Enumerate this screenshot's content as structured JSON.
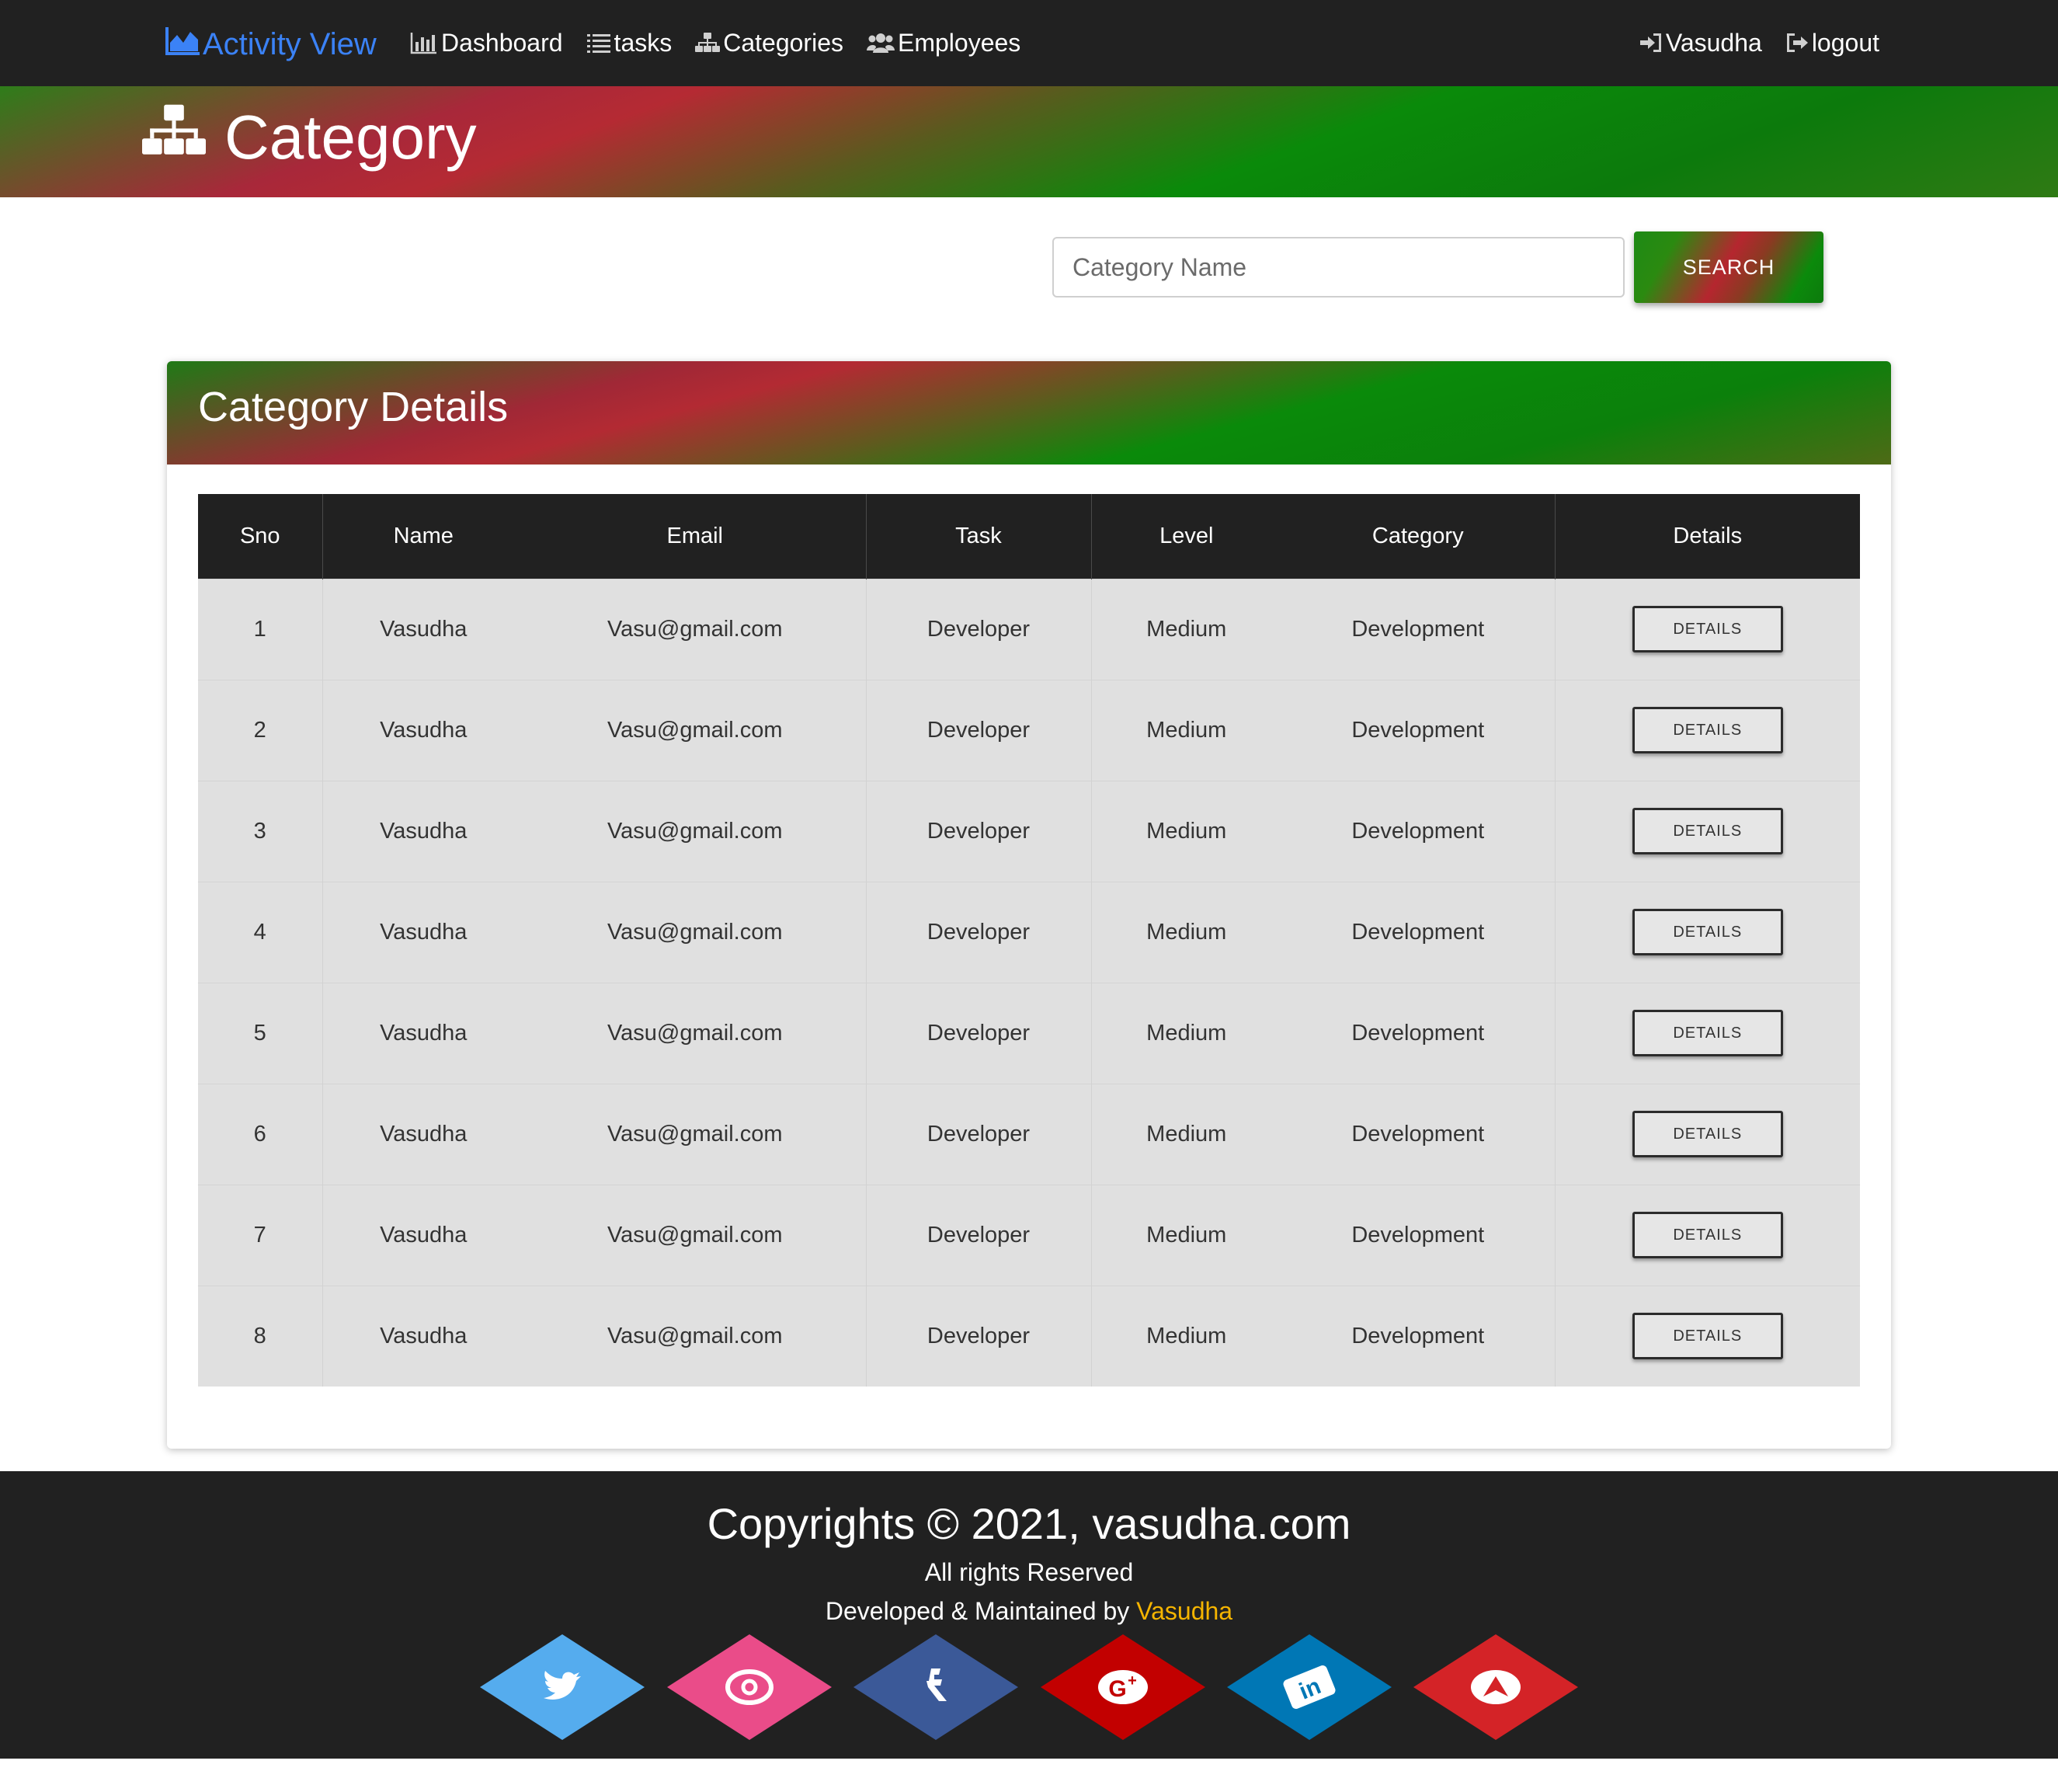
{
  "nav": {
    "brand": "Activity View",
    "links": [
      {
        "label": "Dashboard",
        "icon": "bar-chart-icon"
      },
      {
        "label": "tasks",
        "icon": "list-icon"
      },
      {
        "label": "Categories",
        "icon": "sitemap-icon"
      },
      {
        "label": "Employees",
        "icon": "users-icon"
      }
    ],
    "user": {
      "label": "Vasudha",
      "icon": "sign-in-icon"
    },
    "logout": {
      "label": "logout",
      "icon": "sign-out-icon"
    }
  },
  "banner": {
    "title": "Category",
    "icon": "sitemap-icon"
  },
  "search": {
    "placeholder": "Category Name",
    "value": "",
    "button_label": "SEARCH"
  },
  "card": {
    "title": "Category Details"
  },
  "table": {
    "columns": [
      "Sno",
      "Name",
      "Email",
      "Task",
      "Level",
      "Category",
      "Details"
    ],
    "rows": [
      {
        "sno": "1",
        "name": "Vasudha",
        "email": "Vasu@gmail.com",
        "task": "Developer",
        "level": "Medium",
        "category": "Development",
        "details": "DETAILS"
      },
      {
        "sno": "2",
        "name": "Vasudha",
        "email": "Vasu@gmail.com",
        "task": "Developer",
        "level": "Medium",
        "category": "Development",
        "details": "DETAILS"
      },
      {
        "sno": "3",
        "name": "Vasudha",
        "email": "Vasu@gmail.com",
        "task": "Developer",
        "level": "Medium",
        "category": "Development",
        "details": "DETAILS"
      },
      {
        "sno": "4",
        "name": "Vasudha",
        "email": "Vasu@gmail.com",
        "task": "Developer",
        "level": "Medium",
        "category": "Development",
        "details": "DETAILS"
      },
      {
        "sno": "5",
        "name": "Vasudha",
        "email": "Vasu@gmail.com",
        "task": "Developer",
        "level": "Medium",
        "category": "Development",
        "details": "DETAILS"
      },
      {
        "sno": "6",
        "name": "Vasudha",
        "email": "Vasu@gmail.com",
        "task": "Developer",
        "level": "Medium",
        "category": "Development",
        "details": "DETAILS"
      },
      {
        "sno": "7",
        "name": "Vasudha",
        "email": "Vasu@gmail.com",
        "task": "Developer",
        "level": "Medium",
        "category": "Development",
        "details": "DETAILS"
      },
      {
        "sno": "8",
        "name": "Vasudha",
        "email": "Vasu@gmail.com",
        "task": "Developer",
        "level": "Medium",
        "category": "Development",
        "details": "DETAILS"
      }
    ]
  },
  "footer": {
    "copyright": "Copyrights © 2021, vasudha.com",
    "rights": "All rights Reserved",
    "developed_prefix": "Developed & Maintained by ",
    "developed_by": "Vasudha",
    "socials": [
      {
        "name": "twitter-icon",
        "color": "#55acee"
      },
      {
        "name": "dribbble-icon",
        "color": "#ea4c89"
      },
      {
        "name": "facebook-icon",
        "color": "#3b5998"
      },
      {
        "name": "google-plus-icon",
        "color": "#c20000"
      },
      {
        "name": "linkedin-icon",
        "color": "#0077b5"
      },
      {
        "name": "paper-plane-icon",
        "color": "#d42327"
      }
    ]
  },
  "colors": {
    "navbar": "#212121",
    "brand": "#3b82f6",
    "accent_green": "#0a8a0a",
    "accent_red": "#b52a33",
    "footer_highlight": "#f5b400"
  }
}
